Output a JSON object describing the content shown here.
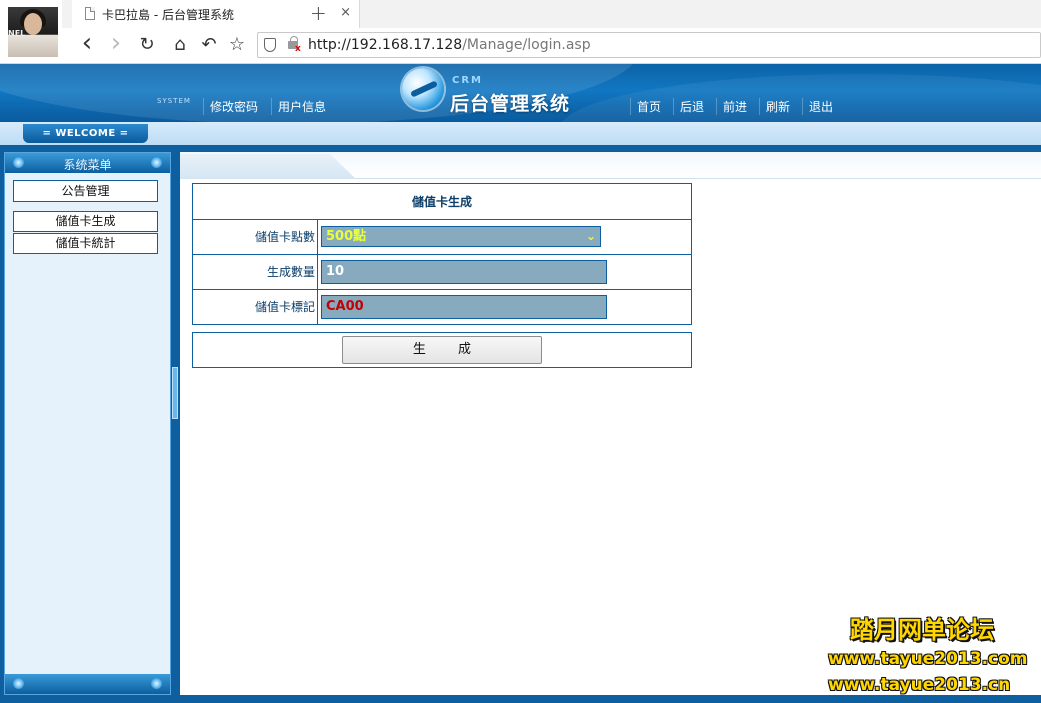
{
  "browser": {
    "tab_title": "卡巴拉島 - 后台管理系统",
    "tab_close": "×",
    "new_tab": "+",
    "url_host": "http://192.168.17.128",
    "url_path": "/Manage/login.asp",
    "nav": {
      "back": "‹",
      "forward": "›",
      "reload": "↻",
      "home": "⌂",
      "undo": "↶",
      "bookmark": "☆"
    }
  },
  "header": {
    "system_small": "SYSTEM",
    "left_links": [
      "修改密码",
      "用户信息"
    ],
    "logo_crm": "CRM",
    "logo_title": "后台管理系统",
    "right_links": [
      "首页",
      "后退",
      "前进",
      "刷新",
      "退出"
    ]
  },
  "welcome": {
    "label": "= WELCOME ="
  },
  "sidebar": {
    "title": "系统菜单",
    "items": [
      {
        "label": "公告管理"
      },
      {
        "label": "儲值卡生成"
      },
      {
        "label": "儲值卡統計"
      }
    ]
  },
  "form": {
    "title": "儲值卡生成",
    "fields": [
      {
        "label": "儲值卡點數",
        "value": "500點",
        "type": "select"
      },
      {
        "label": "生成數量",
        "value": "10",
        "type": "text"
      },
      {
        "label": "儲值卡標記",
        "value": "CA00",
        "type": "text"
      }
    ],
    "submit_label": "生 成",
    "colors": {
      "input_bg": "#88aabf",
      "select_text": "#e8ff3a",
      "mark_text": "#c40000",
      "border": "#0d5f9f"
    }
  },
  "watermark": {
    "line1": "踏月网单论坛",
    "line2": "www.tayue2013.com",
    "line3": "www.tayue2013.cn"
  },
  "icons": [
    "doc-icon",
    "shield-icon",
    "lock-insecure-icon",
    "chevron-down-icon",
    "circle-dot-icon"
  ]
}
